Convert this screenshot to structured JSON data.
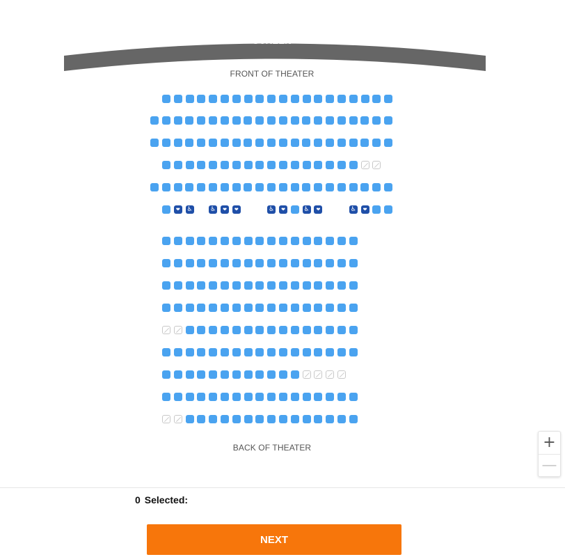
{
  "screen": {
    "label": "SCREEN"
  },
  "front_label": "FRONT OF THEATER",
  "back_label": "BACK OF THEATER",
  "colors": {
    "available": "#4aa3f0",
    "accessible": "#1f4fa8",
    "unavailable_border": "#c8c8c8",
    "next_button": "#f7760b",
    "screen": "#666666"
  },
  "icons": {
    "wheelchair": "wheelchair-icon",
    "companion": "companion-icon",
    "unavailable": "unavailable-slash-icon",
    "zoom_in": "plus-icon",
    "zoom_out": "minus-icon"
  },
  "seat_rows": [
    "aaaaaaaaaaaaaaaaaaaa",
    "aaaaaaaaaaaaaaaaaaaaa",
    "aaaaaaaaaaaaaaaaaaaaa",
    "aaaaaaaaaaaaaaaaaxx",
    "aaaaaaaaaaaaaaaaaaaaa",
    "acw.wcc..wcawc..wcaa",
    "aaaaaaaaaaaaaaaaa",
    "aaaaaaaaaaaaaaaaa",
    "aaaaaaaaaaaaaaaaa",
    "aaaaaaaaaaaaaaaaa",
    "xxaaaaaaaaaaaaaaa",
    "aaaaaaaaaaaaaaaaa",
    "aaaaaaaaaaaaxxxx",
    "aaaaaaaaaaaaaaaaa",
    "xxaaaaaaaaaaaaaaa"
  ],
  "zoom": {
    "in_label": "+",
    "out_label": "—"
  },
  "selection": {
    "count": "0",
    "label": "Selected:"
  },
  "next_button": {
    "label": "NEXT"
  }
}
